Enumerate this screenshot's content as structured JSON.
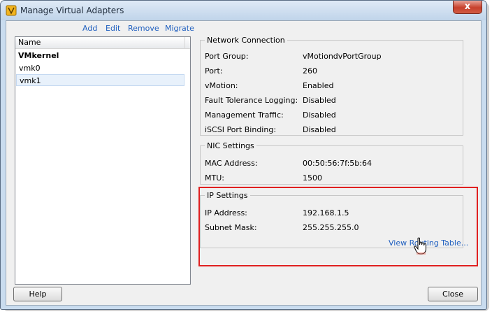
{
  "window": {
    "title": "Manage Virtual Adapters",
    "close_glyph": "x"
  },
  "toolbar": {
    "add": "Add",
    "edit": "Edit",
    "remove": "Remove",
    "migrate": "Migrate"
  },
  "list": {
    "column_header": "Name",
    "group": "VMkernel",
    "items": [
      {
        "label": "vmk0"
      },
      {
        "label": "vmk1"
      }
    ],
    "selected": "vmk1"
  },
  "network_connection": {
    "legend": "Network Connection",
    "rows": [
      {
        "label": "Port Group:",
        "value": "vMotiondvPortGroup"
      },
      {
        "label": "Port:",
        "value": "260"
      },
      {
        "label": "vMotion:",
        "value": "Enabled"
      },
      {
        "label": "Fault Tolerance Logging:",
        "value": "Disabled"
      },
      {
        "label": "Management Traffic:",
        "value": "Disabled"
      },
      {
        "label": "iSCSI Port Binding:",
        "value": "Disabled"
      }
    ]
  },
  "nic_settings": {
    "legend": "NIC Settings",
    "rows": [
      {
        "label": "MAC Address:",
        "value": "00:50:56:7f:5b:64"
      },
      {
        "label": "MTU:",
        "value": "1500"
      }
    ]
  },
  "ip_settings": {
    "legend": "IP Settings",
    "rows": [
      {
        "label": "IP Address:",
        "value": "192.168.1.5"
      },
      {
        "label": "Subnet Mask:",
        "value": "255.255.255.0"
      }
    ],
    "routing_link": "View Routing Table..."
  },
  "buttons": {
    "help": "Help",
    "close": "Close"
  },
  "colors": {
    "link": "#1f5fbf",
    "highlight": "#e02020",
    "selection": "#e8f1fb"
  },
  "icons": [
    "vsphere-app-icon",
    "close-icon",
    "hand-pointer-cursor-icon"
  ]
}
